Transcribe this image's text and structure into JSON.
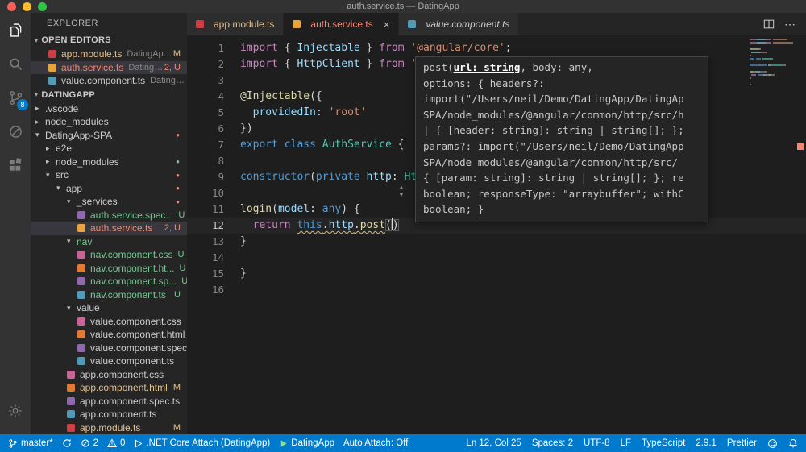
{
  "window": {
    "title": "auth.service.ts — DatingApp"
  },
  "colors": {
    "status_bar_bg": "#007ACC",
    "modified": "#E2C08D",
    "untracked": "#73C991",
    "error": "#F48771",
    "accent_badge": "#007ACC"
  },
  "activity_bar": {
    "items": [
      {
        "name": "explorer",
        "active": true
      },
      {
        "name": "search"
      },
      {
        "name": "source-control",
        "badge": "8"
      },
      {
        "name": "debug"
      },
      {
        "name": "extensions"
      }
    ],
    "bottom": [
      {
        "name": "settings"
      }
    ]
  },
  "sidebar": {
    "title": "EXPLORER",
    "open_editors": {
      "header": "OPEN EDITORS",
      "items": [
        {
          "icon": "ngm",
          "label": "app.module.ts",
          "detail": "DatingApp-...",
          "badge": "M",
          "color": "modified"
        },
        {
          "icon": "ng",
          "label": "auth.service.ts",
          "detail": "DatingAp...",
          "badge": "2, U",
          "color": "error",
          "selected": true
        },
        {
          "icon": "ts",
          "label": "value.component.ts",
          "detail": "DatingApp...",
          "color": "default"
        }
      ]
    },
    "tree": {
      "header": "DATINGAPP",
      "items": [
        {
          "label": ".vscode",
          "level": 1,
          "twisty": "collapsed"
        },
        {
          "label": "node_modules",
          "level": 1,
          "twisty": "collapsed"
        },
        {
          "label": "DatingApp-SPA",
          "level": 1,
          "twisty": "expanded",
          "dot": "red"
        },
        {
          "label": "e2e",
          "level": 2,
          "twisty": "collapsed"
        },
        {
          "label": "node_modules",
          "level": 2,
          "twisty": "collapsed",
          "dot": "green"
        },
        {
          "label": "src",
          "level": 2,
          "twisty": "expanded",
          "dot": "red"
        },
        {
          "label": "app",
          "level": 3,
          "twisty": "expanded",
          "dot": "red"
        },
        {
          "label": "_services",
          "level": 4,
          "twisty": "expanded",
          "dot": "red"
        },
        {
          "label": "auth.service.spec...",
          "level": 5,
          "icon": "spec",
          "badge": "U",
          "color": "untracked"
        },
        {
          "label": "auth.service.ts",
          "level": 5,
          "icon": "ng",
          "badge": "2, U",
          "color": "error",
          "selected": true
        },
        {
          "label": "nav",
          "level": 4,
          "twisty": "expanded",
          "color": "untracked"
        },
        {
          "label": "nav.component.css",
          "level": 5,
          "icon": "css",
          "badge": "U",
          "color": "untracked"
        },
        {
          "label": "nav.component.ht...",
          "level": 5,
          "icon": "html",
          "badge": "U",
          "color": "untracked"
        },
        {
          "label": "nav.component.sp...",
          "level": 5,
          "icon": "spec",
          "badge": "U",
          "color": "untracked"
        },
        {
          "label": "nav.component.ts",
          "level": 5,
          "icon": "ts",
          "badge": "U",
          "color": "untracked"
        },
        {
          "label": "value",
          "level": 4,
          "twisty": "expanded"
        },
        {
          "label": "value.component.css",
          "level": 5,
          "icon": "css"
        },
        {
          "label": "value.component.html",
          "level": 5,
          "icon": "html"
        },
        {
          "label": "value.component.spec...",
          "level": 5,
          "icon": "spec"
        },
        {
          "label": "value.component.ts",
          "level": 5,
          "icon": "ts"
        },
        {
          "label": "app.component.css",
          "level": 4,
          "icon": "css"
        },
        {
          "label": "app.component.html",
          "level": 4,
          "icon": "html",
          "badge": "M",
          "color": "modified"
        },
        {
          "label": "app.component.spec.ts",
          "level": 4,
          "icon": "spec"
        },
        {
          "label": "app.component.ts",
          "level": 4,
          "icon": "ts"
        },
        {
          "label": "app.module.ts",
          "level": 4,
          "icon": "ngm",
          "badge": "M",
          "color": "modified"
        }
      ]
    }
  },
  "tabs": [
    {
      "label": "app.module.ts",
      "icon": "ngm",
      "color": "modified"
    },
    {
      "label": "auth.service.ts",
      "icon": "ng",
      "color": "error",
      "active": true,
      "close": "×"
    },
    {
      "label": "value.component.ts",
      "icon": "ts",
      "color": "default",
      "preview": true
    }
  ],
  "editor_actions": {
    "more": "⋯"
  },
  "editor": {
    "lines": [
      {
        "n": "1",
        "tokens": [
          {
            "t": "import",
            "c": "kw"
          },
          {
            "t": " { ",
            "c": "pl"
          },
          {
            "t": "Injectable",
            "c": "vr"
          },
          {
            "t": " } ",
            "c": "pl"
          },
          {
            "t": "from",
            "c": "kw"
          },
          {
            "t": " ",
            "c": "pl"
          },
          {
            "t": "'@angular/core'",
            "c": "st"
          },
          {
            "t": ";",
            "c": "pl"
          }
        ]
      },
      {
        "n": "2",
        "tokens": [
          {
            "t": "import",
            "c": "kw"
          },
          {
            "t": " { ",
            "c": "pl"
          },
          {
            "t": "HttpClient",
            "c": "vr"
          },
          {
            "t": " } ",
            "c": "pl"
          },
          {
            "t": "from",
            "c": "kw"
          },
          {
            "t": " ",
            "c": "pl"
          },
          {
            "t": "'@angular/common/http'",
            "c": "st"
          },
          {
            "t": ";",
            "c": "pl"
          }
        ]
      },
      {
        "n": "3",
        "tokens": []
      },
      {
        "n": "4",
        "tokens": [
          {
            "t": "@Injectable",
            "c": "fn"
          },
          {
            "t": "({",
            "c": "pl"
          }
        ]
      },
      {
        "n": "5",
        "tokens": [
          {
            "t": "  ",
            "c": "pl"
          },
          {
            "t": "providedIn",
            "c": "vr"
          },
          {
            "t": ": ",
            "c": "pl"
          },
          {
            "t": "'root'",
            "c": "st"
          }
        ]
      },
      {
        "n": "6",
        "tokens": [
          {
            "t": "})",
            "c": "pl"
          }
        ]
      },
      {
        "n": "7",
        "tokens": [
          {
            "t": "export",
            "c": "bl"
          },
          {
            "t": " ",
            "c": "pl"
          },
          {
            "t": "class",
            "c": "bl"
          },
          {
            "t": " ",
            "c": "pl"
          },
          {
            "t": "AuthService",
            "c": "ty"
          },
          {
            "t": " {",
            "c": "pl"
          }
        ]
      },
      {
        "n": "8",
        "tokens": []
      },
      {
        "n": "9",
        "tokens": [
          {
            "t": "constructor",
            "c": "bl"
          },
          {
            "t": "(",
            "c": "pl"
          },
          {
            "t": "private",
            "c": "bl"
          },
          {
            "t": " ",
            "c": "pl"
          },
          {
            "t": "http",
            "c": "vr"
          },
          {
            "t": ": ",
            "c": "pl"
          },
          {
            "t": "HttpClient",
            "c": "ty"
          },
          {
            "t": ") { }",
            "c": "pl"
          }
        ]
      },
      {
        "n": "10",
        "tokens": []
      },
      {
        "n": "11",
        "tokens": [
          {
            "t": "login",
            "c": "fn"
          },
          {
            "t": "(",
            "c": "pl"
          },
          {
            "t": "model",
            "c": "vr"
          },
          {
            "t": ": ",
            "c": "pl"
          },
          {
            "t": "any",
            "c": "bl"
          },
          {
            "t": ") {",
            "c": "pl"
          }
        ]
      },
      {
        "n": "12",
        "active": true,
        "tokens": [
          {
            "t": "  ",
            "c": "pl"
          },
          {
            "t": "return",
            "c": "kw"
          },
          {
            "t": " ",
            "c": "pl"
          },
          {
            "t": "this",
            "c": "bl",
            "sq": true
          },
          {
            "t": ".",
            "c": "pl",
            "sq": true
          },
          {
            "t": "http",
            "c": "vr",
            "sq": true
          },
          {
            "t": ".",
            "c": "pl",
            "sq": true
          },
          {
            "t": "post",
            "c": "fn",
            "sq": true
          },
          {
            "t": "(",
            "c": "pl",
            "br": true,
            "caret": true
          },
          {
            "t": ")",
            "c": "pl",
            "br": true
          }
        ]
      },
      {
        "n": "13",
        "tokens": [
          {
            "t": "}",
            "c": "pl"
          }
        ]
      },
      {
        "n": "14",
        "tokens": []
      },
      {
        "n": "15",
        "tokens": [
          {
            "t": "}",
            "c": "pl"
          }
        ]
      },
      {
        "n": "16",
        "tokens": []
      }
    ]
  },
  "hover": {
    "sig_prefix": "post(",
    "sig_active": "url: string",
    "sig_suffix": ", body: any,",
    "lines": [
      "options: { headers?:",
      "import(\"/Users/neil/Demo/DatingApp/DatingAp",
      "SPA/node_modules/@angular/common/http/src/h",
      "| { [header: string]: string | string[]; };",
      "params?: import(\"/Users/neil/Demo/DatingApp",
      "SPA/node_modules/@angular/common/http/src/",
      "{ [param: string]: string | string[]; }; re",
      "boolean; responseType: \"arraybuffer\"; withC",
      "boolean; }"
    ]
  },
  "status_bar": {
    "left": [
      {
        "name": "git-branch",
        "icon": "branch",
        "text": "master*"
      },
      {
        "name": "sync",
        "icon": "sync",
        "text": ""
      },
      {
        "name": "errors",
        "icon": "error",
        "text": "2"
      },
      {
        "name": "warnings",
        "icon": "warning",
        "text": "0"
      },
      {
        "name": "debug-config",
        "icon": "debug-play",
        "text": ".NET Core Attach (DatingApp)"
      },
      {
        "name": "run-task",
        "icon": "run-green",
        "text": "DatingApp"
      },
      {
        "name": "auto-attach",
        "text": "Auto Attach: Off"
      }
    ],
    "right": [
      {
        "name": "cursor-position",
        "text": "Ln 12, Col 25"
      },
      {
        "name": "indentation",
        "text": "Spaces: 2"
      },
      {
        "name": "encoding",
        "text": "UTF-8"
      },
      {
        "name": "eol",
        "text": "LF"
      },
      {
        "name": "language-mode",
        "text": "TypeScript"
      },
      {
        "name": "ts-version",
        "text": "2.9.1"
      },
      {
        "name": "formatter",
        "text": "Prettier"
      },
      {
        "name": "feedback",
        "icon": "smiley",
        "text": ""
      },
      {
        "name": "notifications",
        "icon": "bell",
        "text": ""
      }
    ]
  }
}
